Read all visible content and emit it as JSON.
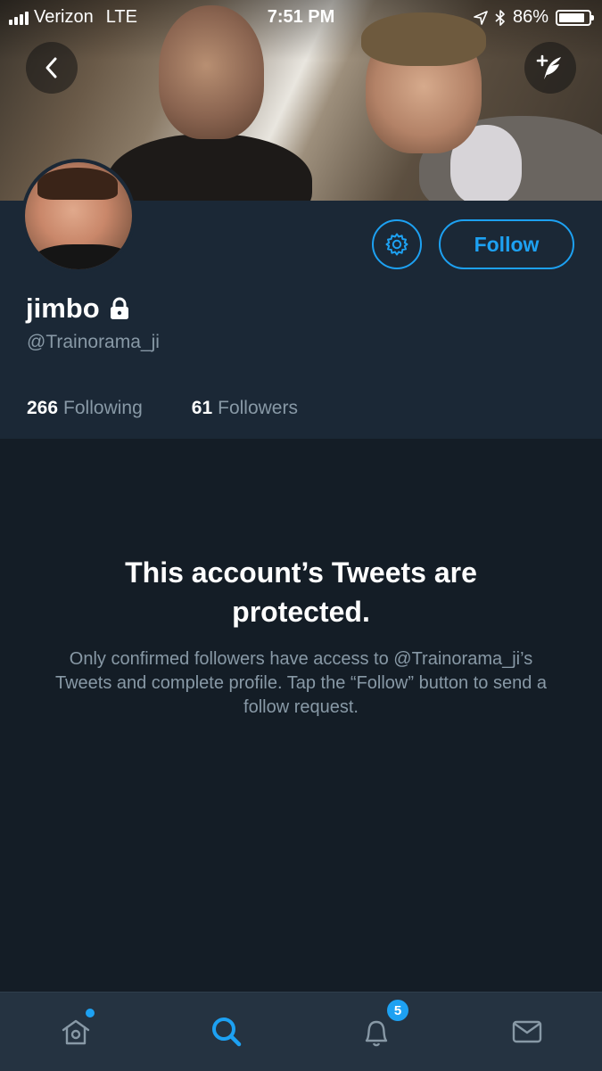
{
  "status_bar": {
    "carrier": "Verizon",
    "network": "LTE",
    "time": "7:51 PM",
    "battery_percent": "86%",
    "battery_level": 0.86
  },
  "header": {
    "back_icon": "chevron-left-icon",
    "compose_icon": "compose-tweet-icon"
  },
  "profile": {
    "name": "jimbo",
    "lock_icon": "lock-icon",
    "handle": "@Trainorama_ji",
    "following_count": "266",
    "following_label": "Following",
    "followers_count": "61",
    "followers_label": "Followers",
    "follow_label": "Follow",
    "settings_icon": "gear-icon"
  },
  "protected": {
    "title": "This account’s Tweets are protected.",
    "body": "Only confirmed followers have access to @Trainorama_ji’s Tweets and complete profile. Tap the “Follow” button to send a follow request."
  },
  "tabbar": {
    "notifications_badge": "5",
    "active_tab": "search"
  },
  "colors": {
    "accent": "#1da1f2",
    "background": "#141d26",
    "panel": "#1b2836",
    "secondary_text": "#8899a6"
  }
}
